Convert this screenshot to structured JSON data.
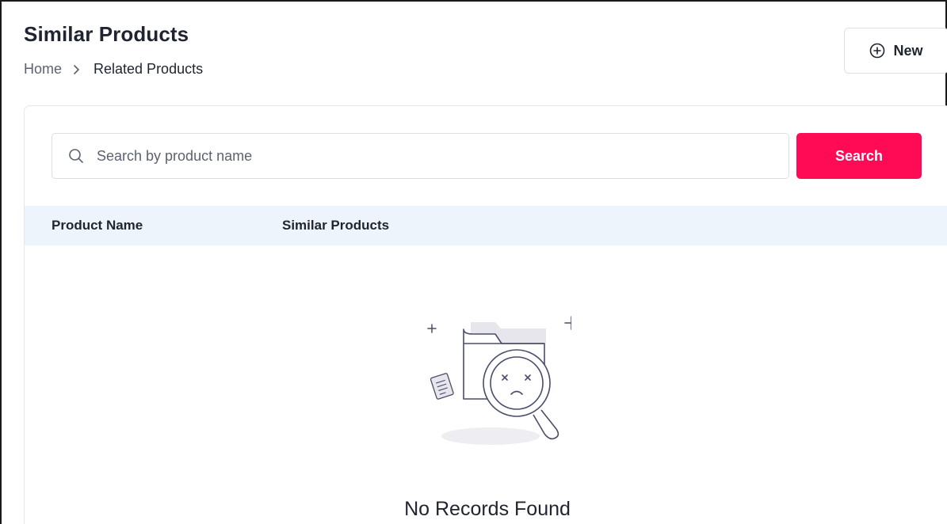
{
  "header": {
    "title": "Similar Products",
    "breadcrumb": {
      "home": "Home",
      "current": "Related Products"
    }
  },
  "toolbar": {
    "new_label": "New"
  },
  "search": {
    "placeholder": "Search by product name",
    "value": "",
    "button_label": "Search"
  },
  "table": {
    "columns": [
      "Product Name",
      "Similar Products"
    ],
    "rows": []
  },
  "empty_state": {
    "message": "No Records Found"
  },
  "colors": {
    "accent": "#ff0a54",
    "table_header_bg": "#eef4fb",
    "text": "#1f2430"
  },
  "icons": {
    "new": "plus-circle-icon",
    "search": "search-icon",
    "breadcrumb_sep": "chevron-right-icon",
    "empty": "no-results-illustration"
  }
}
